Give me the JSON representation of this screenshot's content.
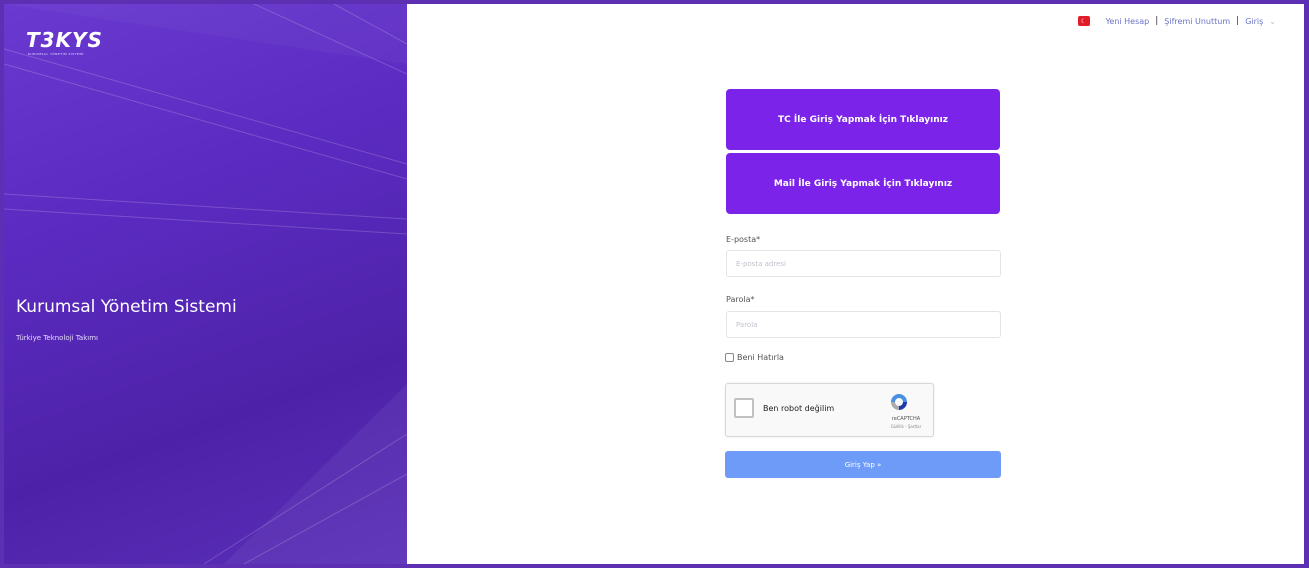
{
  "brand": {
    "logo_text": "T3KYS",
    "logo_subtitle": "KURUMSAL YÖNETİM SİSTEMİ",
    "title": "Kurumsal Yönetim Sistemi",
    "subtitle": "Türkiye Teknoloji Takımı"
  },
  "nav": {
    "flag_icon": "turkey-flag-icon",
    "new_account": "Yeni Hesap",
    "separator": "|",
    "forgot_password": "Şifremi Unuttum",
    "login_menu": "Giriş",
    "dropdown_glyph": "⌄"
  },
  "login_options": {
    "tc_button": "TC İle Giriş Yapmak İçin Tıklayınız",
    "mail_button": "Mail İle Giriş Yapmak İçin Tıklayınız"
  },
  "form": {
    "email_label": "E-posta*",
    "email_placeholder": "E-posta adresi",
    "email_value": "",
    "password_label": "Parola*",
    "password_placeholder": "Parola",
    "password_value": "",
    "remember_label": "Beni Hatırla",
    "remember_checked": false,
    "submit_label": "Giriş Yap »"
  },
  "captcha": {
    "label": "Ben robot değilim",
    "brand": "reCAPTCHA",
    "terms": "Gizlilik - Şartlar"
  },
  "colors": {
    "primary_purple": "#7b23e8",
    "panel_purple": "#5b2bc1",
    "submit_blue": "#6d9bf7",
    "link_blue": "#6a74c4"
  }
}
